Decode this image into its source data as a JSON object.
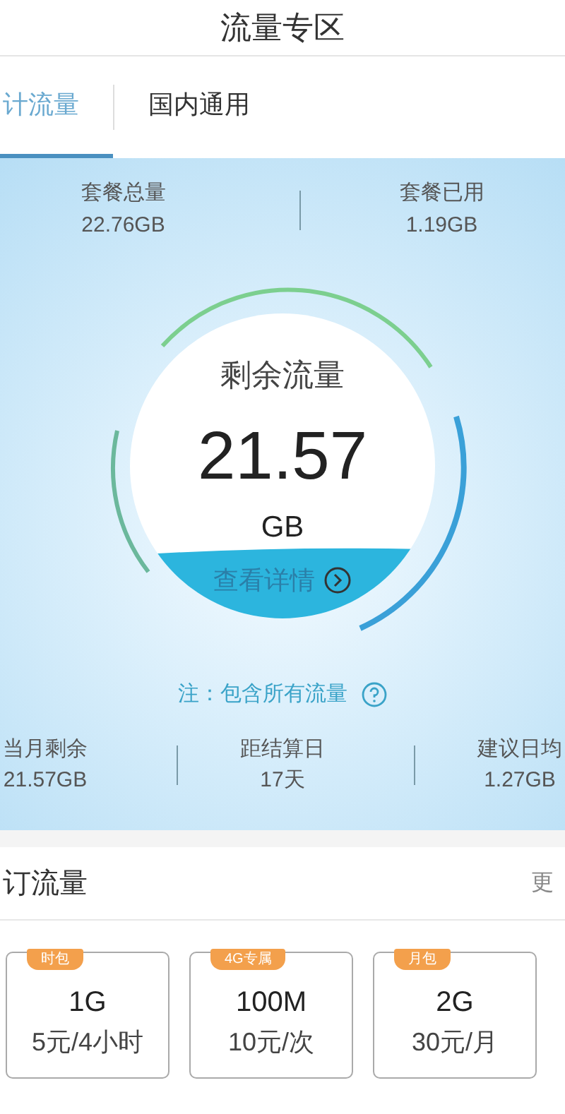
{
  "header": {
    "title": "流量专区"
  },
  "tabs": [
    {
      "label": "计流量",
      "selected": true
    },
    {
      "label": "国内通用",
      "selected": false
    }
  ],
  "summary": [
    {
      "label": "套餐总量",
      "value": "22.76GB"
    },
    {
      "label": "套餐已用",
      "value": "1.19GB"
    }
  ],
  "gauge": {
    "label": "剩余流量",
    "amount": "21.57",
    "unit": "GB",
    "link": "查看详情"
  },
  "note": "注：包含所有流量",
  "stats": [
    {
      "label": "当月剩余",
      "value": "21.57GB"
    },
    {
      "label": "距结算日",
      "value": "17天"
    },
    {
      "label": "建议日均",
      "value": "1.27GB"
    }
  ],
  "packages": {
    "title": "订流量",
    "more": "更",
    "items": [
      {
        "badge": "时包",
        "size": "1G",
        "price": "5元/4小时"
      },
      {
        "badge": "4G专属",
        "size": "100M",
        "price": "10元/次"
      },
      {
        "badge": "月包",
        "size": "2G",
        "price": "30元/月"
      }
    ]
  }
}
